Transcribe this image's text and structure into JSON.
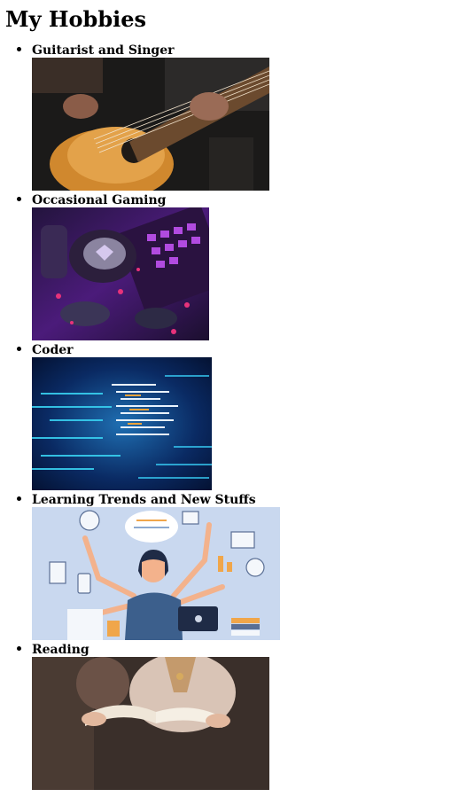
{
  "page": {
    "title": "My Hobbies"
  },
  "hobbies": [
    {
      "label": "Guitarist and Singer",
      "icon": "guitar-photo"
    },
    {
      "label": "Occasional Gaming",
      "icon": "gaming-setup-photo"
    },
    {
      "label": "Coder",
      "icon": "code-screen-photo"
    },
    {
      "label": "Learning Trends and New Stuffs",
      "icon": "multitasking-woman-illustration"
    },
    {
      "label": "Reading",
      "icon": "reading-book-photo"
    }
  ]
}
